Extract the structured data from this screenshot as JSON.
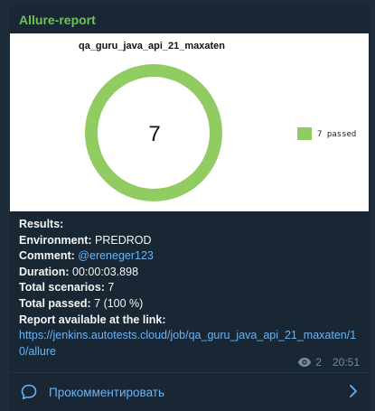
{
  "message": {
    "sender": "Allure-report",
    "results_label": "Results:",
    "environment_label": "Environment:",
    "environment_value": "PREDROD",
    "comment_label": "Comment:",
    "comment_value": "@ereneger123",
    "duration_label": "Duration:",
    "duration_value": "00:00:03.898",
    "total_scenarios_label": "Total scenarios:",
    "total_scenarios_value": "7",
    "total_passed_label": "Total passed:",
    "total_passed_value": "7 (100 %)",
    "report_label": "Report available at the link:",
    "report_link": "https://jenkins.autotests.cloud/job/qa_guru_java_api_21_maxaten/10/allure",
    "views": "2",
    "time": "20:51"
  },
  "comment_action": {
    "label": "Прокомментировать"
  },
  "chart_data": {
    "type": "pie",
    "title": "qa_guru_java_api_21_maxaten",
    "center_label": "7",
    "legend_position": "right",
    "slices": [
      {
        "name": "7 passed",
        "value": 7,
        "color": "#91cc63"
      }
    ]
  },
  "colors": {
    "accent": "#6ab3f3",
    "sender": "#6fc25a",
    "passed": "#91cc63"
  }
}
